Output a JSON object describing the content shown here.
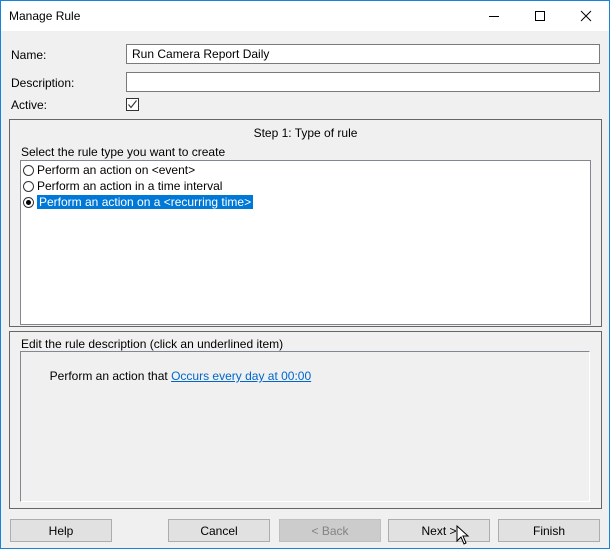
{
  "window": {
    "title": "Manage Rule",
    "accent": "#1883d7"
  },
  "form": {
    "name_label": "Name:",
    "name_value": "Run Camera Report Daily",
    "description_label": "Description:",
    "description_value": "",
    "active_label": "Active:",
    "active_checked": true
  },
  "step": {
    "title": "Step 1: Type of rule",
    "prompt": "Select the rule type you want to create",
    "options": [
      {
        "label": "Perform an action on <event>",
        "selected": false
      },
      {
        "label": "Perform an action in a time interval",
        "selected": false
      },
      {
        "label": "Perform an action on a <recurring time>",
        "selected": true
      }
    ],
    "selection_color": "#0078d7"
  },
  "rule_description": {
    "header": "Edit the rule description (click an underlined item)",
    "prefix": "Perform an action that ",
    "link": "Occurs every day at 00:00"
  },
  "buttons": {
    "help": "Help",
    "cancel": "Cancel",
    "back": "< Back",
    "next": "Next >",
    "finish": "Finish"
  }
}
